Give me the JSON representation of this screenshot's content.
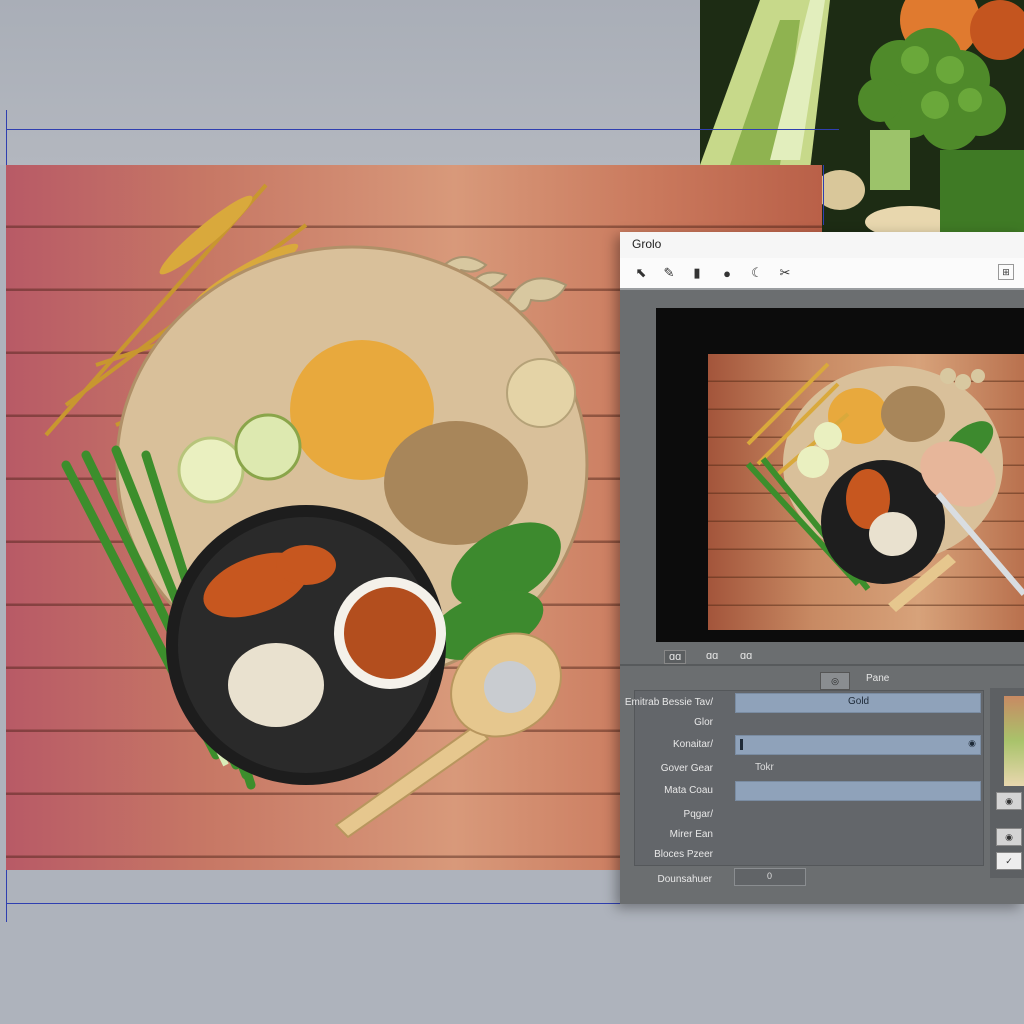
{
  "editor": {
    "title": "Grolo",
    "tools": [
      "pointer-icon",
      "brush-icon",
      "layer-icon",
      "circle-icon",
      "moon-icon",
      "crop-icon"
    ],
    "canvas_status": [
      "ɑɑ ",
      "ɑɑ",
      "ɑɑ"
    ],
    "panel_tab": "Pane",
    "props": {
      "rows": [
        {
          "label": "Emitrab Bessie Tav/",
          "value": "Gold"
        },
        {
          "label": "Glor",
          "value": ""
        },
        {
          "label": "Konaitar/",
          "value": ""
        },
        {
          "label": "Gover Gear",
          "value": "Tokr"
        },
        {
          "label": "Mata Coau",
          "value": ""
        },
        {
          "label": "Pqgar/",
          "value": ""
        },
        {
          "label": "Mirer Ean",
          "value": ""
        },
        {
          "label": "Bloces Pzeer",
          "value": ""
        }
      ],
      "footer_label": "Dounsahuer",
      "footer_value": "0"
    }
  },
  "colors": {
    "editor_bg": "#6b6e70",
    "field_blue": "#8fa2ba",
    "guide": "#2f3fb0"
  }
}
